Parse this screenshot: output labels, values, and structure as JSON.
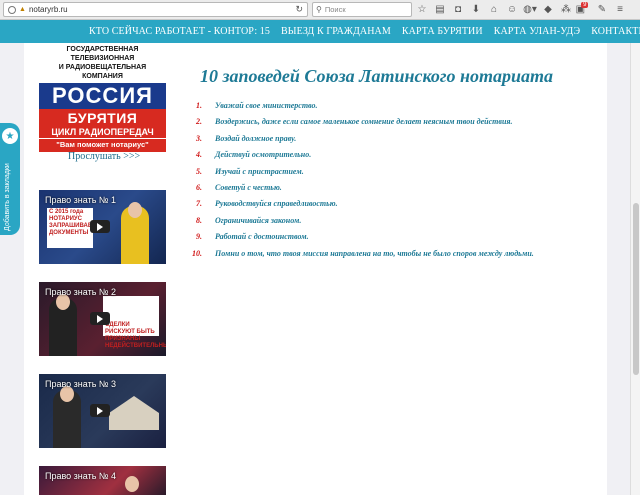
{
  "browser": {
    "url": "notaryrb.ru",
    "search_placeholder": "Поиск",
    "badge_count": "9"
  },
  "nav": {
    "items": [
      "КТО СЕЙЧАС РАБОТАЕТ - КОНТОР: 15",
      "ВЫЕЗД К ГРАЖДАНАМ",
      "КАРТА БУРЯТИИ",
      "КАРТА УЛАН-УДЭ",
      "КОНТАКТЫ"
    ]
  },
  "bookmark": {
    "label": "Добавить в закладки"
  },
  "banner": {
    "line1": "ГОСУДАРСТВЕННАЯ ТЕЛЕВИЗИОННАЯ",
    "line2": "И РАДИОВЕЩАТЕЛЬНАЯ КОМПАНИЯ",
    "rossiya": "РОССИЯ",
    "buryatia": "БУРЯТИЯ",
    "cycle": "ЦИКЛ РАДИОПЕРЕДАЧ",
    "quote": "\"Вам поможет нотариус\""
  },
  "listen_link": "Прослушать >>>",
  "videos": [
    {
      "title": "Право знать № 1",
      "panel_text": "С 2015 года НОТАРИУС ЗАПРАШИВАЕТ ДОКУМЕНТЫ"
    },
    {
      "title": "Право знать № 2",
      "panel_text": "СДЕЛКИ РИСКУЮТ БЫТЬ ПРИЗНАНЫ НЕДЕЙСТВИТЕЛЬНЫМИ"
    },
    {
      "title": "Право знать № 3",
      "panel_text": ""
    },
    {
      "title": "Право знать № 4",
      "panel_text": ""
    }
  ],
  "main": {
    "title": "10 заповедей Союза Латинского нотариата",
    "commandments": [
      {
        "num": "1.",
        "text": "Уважай свое министерство."
      },
      {
        "num": "2.",
        "text": "Воздержись, даже если самое маленькое сомнение делает неясным твои действия."
      },
      {
        "num": "3.",
        "text": "Воздай должное праву."
      },
      {
        "num": "4.",
        "text": "Действуй осмотрительно."
      },
      {
        "num": "5.",
        "text": "Изучай с пристрастием."
      },
      {
        "num": "6.",
        "text": "Советуй с честью."
      },
      {
        "num": "7.",
        "text": "Руководствуйся справедливостью."
      },
      {
        "num": "8.",
        "text": "Ограничивайся законом."
      },
      {
        "num": "9.",
        "text": "Работай с достоинством."
      },
      {
        "num": "10.",
        "text": "Помни о том, что твоя миссия направлена на то, чтобы не было споров между людьми."
      }
    ]
  },
  "colors": {
    "accent": "#2aa6c4",
    "title": "#1e7a96",
    "number": "#d01818"
  }
}
